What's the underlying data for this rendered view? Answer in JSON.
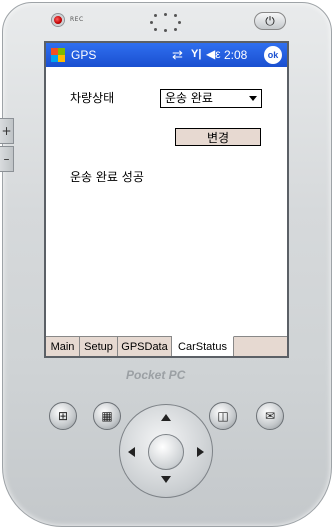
{
  "device": {
    "rec_label": "REC",
    "brand": "Pocket PC",
    "side_buttons": [
      "+",
      "–"
    ],
    "power_icon": "power-icon"
  },
  "titlebar": {
    "title": "GPS",
    "clock": "2:08",
    "ok_label": "ok",
    "bg_color": "#1a4fd0"
  },
  "form": {
    "vehicle_status_label": "차량상태",
    "status_value": "운송 완료",
    "change_button_label": "변경",
    "result_message": "운송 완료 성공",
    "button_color": "#e7d9d1"
  },
  "tabs": [
    {
      "label": "Main",
      "active": false
    },
    {
      "label": "Setup",
      "active": false
    },
    {
      "label": "GPSData",
      "active": false
    },
    {
      "label": "CarStatus",
      "active": true
    }
  ],
  "hardware_buttons": {
    "left1": "windows-icon",
    "left2": "calendar-icon",
    "right1": "contacts-icon",
    "right2": "inbox-icon"
  }
}
